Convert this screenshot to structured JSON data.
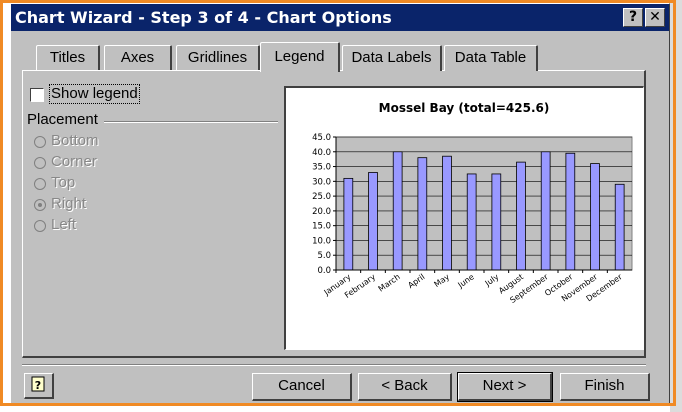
{
  "window": {
    "title": "Chart Wizard - Step 3 of 4 - Chart Options",
    "help_label": "?",
    "close_label": "✕"
  },
  "tabs": [
    {
      "label": "Titles"
    },
    {
      "label": "Axes"
    },
    {
      "label": "Gridlines"
    },
    {
      "label": "Legend",
      "active": true
    },
    {
      "label": "Data Labels"
    },
    {
      "label": "Data Table"
    }
  ],
  "legend": {
    "show_legend_label": "Show legend",
    "show_legend_checked": false,
    "placement_label": "Placement",
    "placement_options": [
      "Bottom",
      "Corner",
      "Top",
      "Right",
      "Left"
    ],
    "placement_selected": "Right",
    "placement_enabled": false
  },
  "buttons": {
    "cancel": "Cancel",
    "back": "< Back",
    "next": "Next >",
    "finish": "Finish"
  },
  "colors": {
    "bar_fill": "#9999ff",
    "plot_bg": "#c0c0c0",
    "title_bar": "#0a246a",
    "selection_outline": "#f08a24"
  },
  "chart_data": {
    "type": "bar",
    "title": "Mossel Bay (total=425.6)",
    "categories": [
      "January",
      "February",
      "March",
      "April",
      "May",
      "June",
      "July",
      "August",
      "September",
      "October",
      "November",
      "December"
    ],
    "values": [
      31,
      33,
      40,
      38,
      38.5,
      32.5,
      32.5,
      36.5,
      40,
      39.5,
      36,
      29
    ],
    "ylim": [
      0,
      45
    ],
    "yticks": [
      "0.0",
      "5.0",
      "10.0",
      "15.0",
      "20.0",
      "25.0",
      "30.0",
      "35.0",
      "40.0",
      "45.0"
    ],
    "grid": true,
    "legend": false
  }
}
